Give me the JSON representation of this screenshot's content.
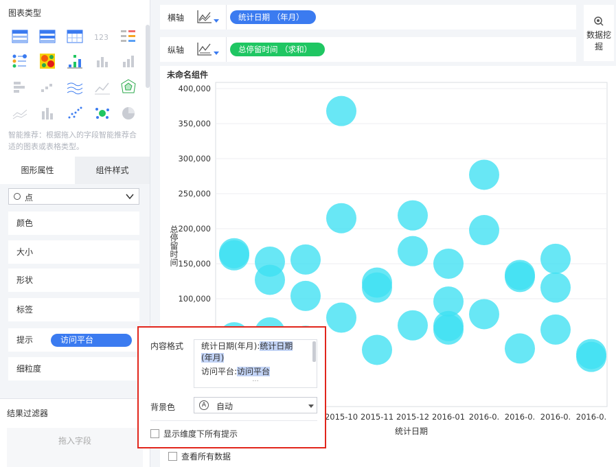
{
  "left_panel": {
    "chart_type_title": "图表类型",
    "recommend_text": "智能推荐：根据拖入的字段智能推荐合适的图表或表格类型。",
    "tabs": [
      {
        "label": "图形属性"
      },
      {
        "label": "组件样式"
      }
    ],
    "shape_select": {
      "value": "点"
    },
    "props": {
      "color": "颜色",
      "size": "大小",
      "shape": "形状",
      "label": "标签",
      "tooltip": "提示",
      "granularity": "细粒度"
    },
    "tooltip_field": "访问平台",
    "filter_title": "结果过滤器",
    "filter_placeholder": "拖入字段"
  },
  "axes": {
    "x_label": "横轴",
    "x_field": "统计日期  （年月）",
    "y_label": "纵轴",
    "y_field": "总停留时间  （求和）"
  },
  "mining_button": "数据挖掘",
  "component_name": "未命名组件",
  "view_all_data": "查看所有数据",
  "popup": {
    "content_format_label": "内容格式",
    "line1_prefix": "统计日期(年月):",
    "line1_highlight": "统计日期",
    "line1b_highlight": "(年月)",
    "line2_prefix": "访问平台:",
    "line2_highlight": "访问平台",
    "more": "···",
    "bg_label": "背景色",
    "bg_icon": "A",
    "bg_value": "自动",
    "show_all_tips": "显示维度下所有提示"
  },
  "colors": {
    "bubble": "#3ee0f2",
    "accent_blue": "#3b7bf0",
    "accent_green": "#1fc662",
    "highlight_red": "#e1251b"
  },
  "chart_data": {
    "type": "scatter",
    "xlabel": "统计日期",
    "ylabel": "总停留时间",
    "categories": [
      "",
      "",
      "",
      "2015-10",
      "2015-11",
      "2015-12",
      "2016-01",
      "2016-0.",
      "2016-0.",
      "2016-0.",
      "2016-0."
    ],
    "ylim": [
      0,
      400000
    ],
    "yticks": [
      "100,000",
      "150,000",
      "200,000",
      "250,000",
      "300,000",
      "350,000",
      "400,000"
    ],
    "ytick_values": [
      100000,
      150000,
      200000,
      250000,
      300000,
      350000,
      400000
    ],
    "points": [
      {
        "x": 0,
        "y": 165000
      },
      {
        "x": 0,
        "y": 162000
      },
      {
        "x": 0,
        "y": 45000
      },
      {
        "x": 1,
        "y": 153000
      },
      {
        "x": 1,
        "y": 127000
      },
      {
        "x": 1,
        "y": 52000
      },
      {
        "x": 2,
        "y": 156000
      },
      {
        "x": 2,
        "y": 104000
      },
      {
        "x": 2,
        "y": 40000
      },
      {
        "x": 3,
        "y": 368000
      },
      {
        "x": 3,
        "y": 215000
      },
      {
        "x": 3,
        "y": 73000
      },
      {
        "x": 4,
        "y": 123000
      },
      {
        "x": 4,
        "y": 116000
      },
      {
        "x": 4,
        "y": 27000
      },
      {
        "x": 5,
        "y": 219000
      },
      {
        "x": 5,
        "y": 168000
      },
      {
        "x": 5,
        "y": 62000
      },
      {
        "x": 6,
        "y": 150000
      },
      {
        "x": 6,
        "y": 96000
      },
      {
        "x": 6,
        "y": 61000
      },
      {
        "x": 6,
        "y": 56000
      },
      {
        "x": 7,
        "y": 277000
      },
      {
        "x": 7,
        "y": 198000
      },
      {
        "x": 7,
        "y": 78000
      },
      {
        "x": 8,
        "y": 134000
      },
      {
        "x": 8,
        "y": 131000
      },
      {
        "x": 8,
        "y": 29000
      },
      {
        "x": 9,
        "y": 157000
      },
      {
        "x": 9,
        "y": 116000
      },
      {
        "x": 9,
        "y": 56000
      },
      {
        "x": 10,
        "y": 21000
      },
      {
        "x": 10,
        "y": 17000
      }
    ]
  }
}
